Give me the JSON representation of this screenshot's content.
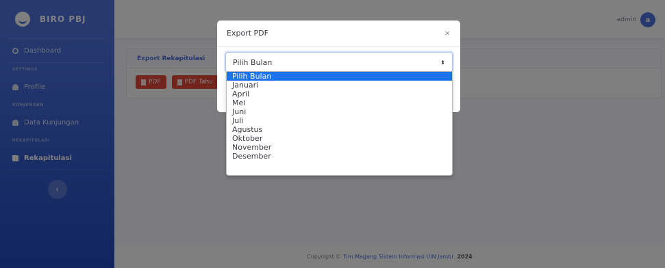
{
  "brand": {
    "name": "BIRO PBJ"
  },
  "sidebar": {
    "dashboard": "Dashboard",
    "heading_settings": "SETTINGS",
    "profile": "Profile",
    "heading_kunjungan": "KUNJUNGAN",
    "data_kunjungan": "Data Kunjungan",
    "heading_rekapitulasi": "REKAPITULASI",
    "rekapitulasi": "Rekapitulasi",
    "toggle_glyph": "‹"
  },
  "topbar": {
    "username": "admin",
    "avatar_letter": "a"
  },
  "card": {
    "title": "Export Rekapitulasi",
    "pdf_button": "PDF",
    "pdf_tahun_button": "PDF Tahu"
  },
  "footer": {
    "prefix": "Copyright ©",
    "link": "Tim Magang Sistem Informasi UIN Jambi",
    "year": "2024"
  },
  "modal": {
    "title": "Export PDF",
    "close": "×",
    "select_value": "Pilih Bulan",
    "select_arrow": "⬍",
    "options": [
      "Pilih Bulan",
      "Januari",
      "April",
      "Mei",
      "Juni",
      "Juli",
      "Agustus",
      "Oktober",
      "November",
      "Desember"
    ]
  },
  "colors": {
    "primary": "#4e73df",
    "danger": "#e74a3b",
    "highlight": "#1a73e8"
  }
}
